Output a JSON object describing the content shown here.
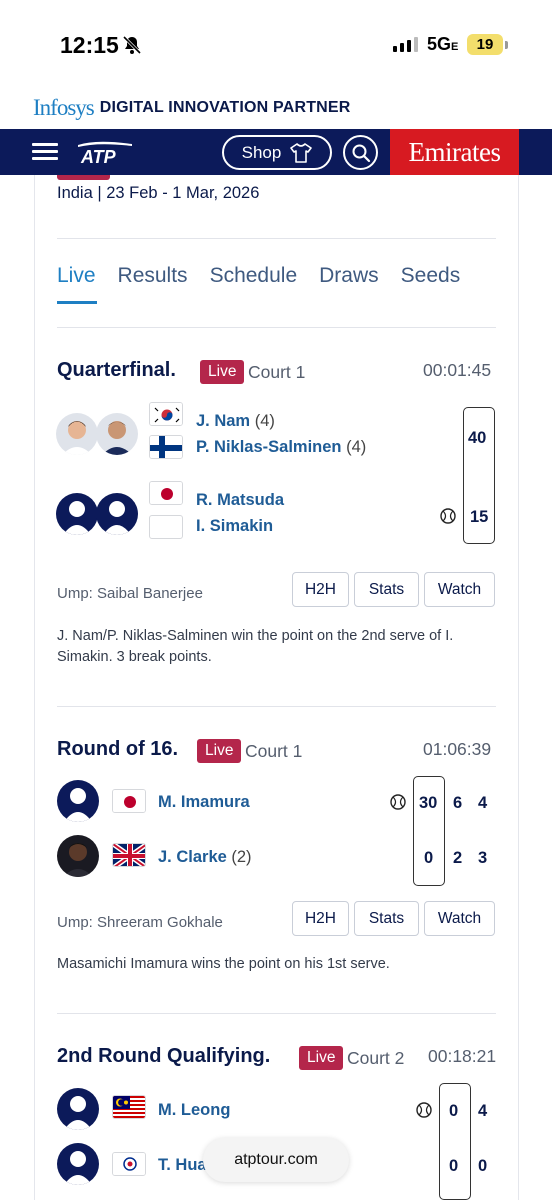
{
  "status": {
    "time": "12:15",
    "network": "5G",
    "network_suffix": "E",
    "battery": "19"
  },
  "sponsor": {
    "brand": "Infosys",
    "tagline": "DIGITAL INNOVATION PARTNER"
  },
  "nav": {
    "shop_label": "Shop",
    "partner_brand": "Emirates"
  },
  "tournament": {
    "location_dates": "India | 23 Feb - 1 Mar, 2026"
  },
  "tabs": [
    {
      "label": "Live",
      "active": true
    },
    {
      "label": "Results"
    },
    {
      "label": "Schedule"
    },
    {
      "label": "Draws"
    },
    {
      "label": "Seeds"
    }
  ],
  "matches": [
    {
      "round": "Quarterfinal",
      "status": "Live",
      "court": "Court 1",
      "duration": "00:01:45",
      "team1": {
        "players": [
          "J. Nam",
          "P. Niklas-Salminen"
        ],
        "seeds": [
          "(4)",
          "(4)"
        ],
        "score": "40"
      },
      "team2": {
        "players": [
          "R. Matsuda",
          "I. Simakin"
        ],
        "score": "15",
        "serving": true
      },
      "umpire": "Ump: Saibal Banerjee",
      "buttons": [
        "H2H",
        "Stats",
        "Watch"
      ],
      "summary": "J. Nam/P. Niklas-Salminen win the point on the 2nd serve of I. Simakin. 3 break points."
    },
    {
      "round": "Round of 16",
      "status": "Live",
      "court": "Court 1",
      "duration": "01:06:39",
      "player1": {
        "name": "M. Imamura",
        "seed": "",
        "game": "30",
        "set1": "6",
        "set2": "4",
        "serving": true
      },
      "player2": {
        "name": "J. Clarke",
        "seed": "(2)",
        "game": "0",
        "set1": "2",
        "set2": "3"
      },
      "umpire": "Ump: Shreeram Gokhale",
      "buttons": [
        "H2H",
        "Stats",
        "Watch"
      ],
      "summary": "Masamichi Imamura wins the point on his 1st serve."
    },
    {
      "round": "2nd Round Qualifying",
      "status": "Live",
      "court": "Court 2",
      "duration": "00:18:21",
      "player1": {
        "name": "M. Leong",
        "game": "0",
        "set1": "4",
        "serving": true
      },
      "player2": {
        "name": "T. Hua",
        "game": "0",
        "set1": "0"
      }
    }
  ],
  "browser": {
    "url": "atptour.com"
  }
}
